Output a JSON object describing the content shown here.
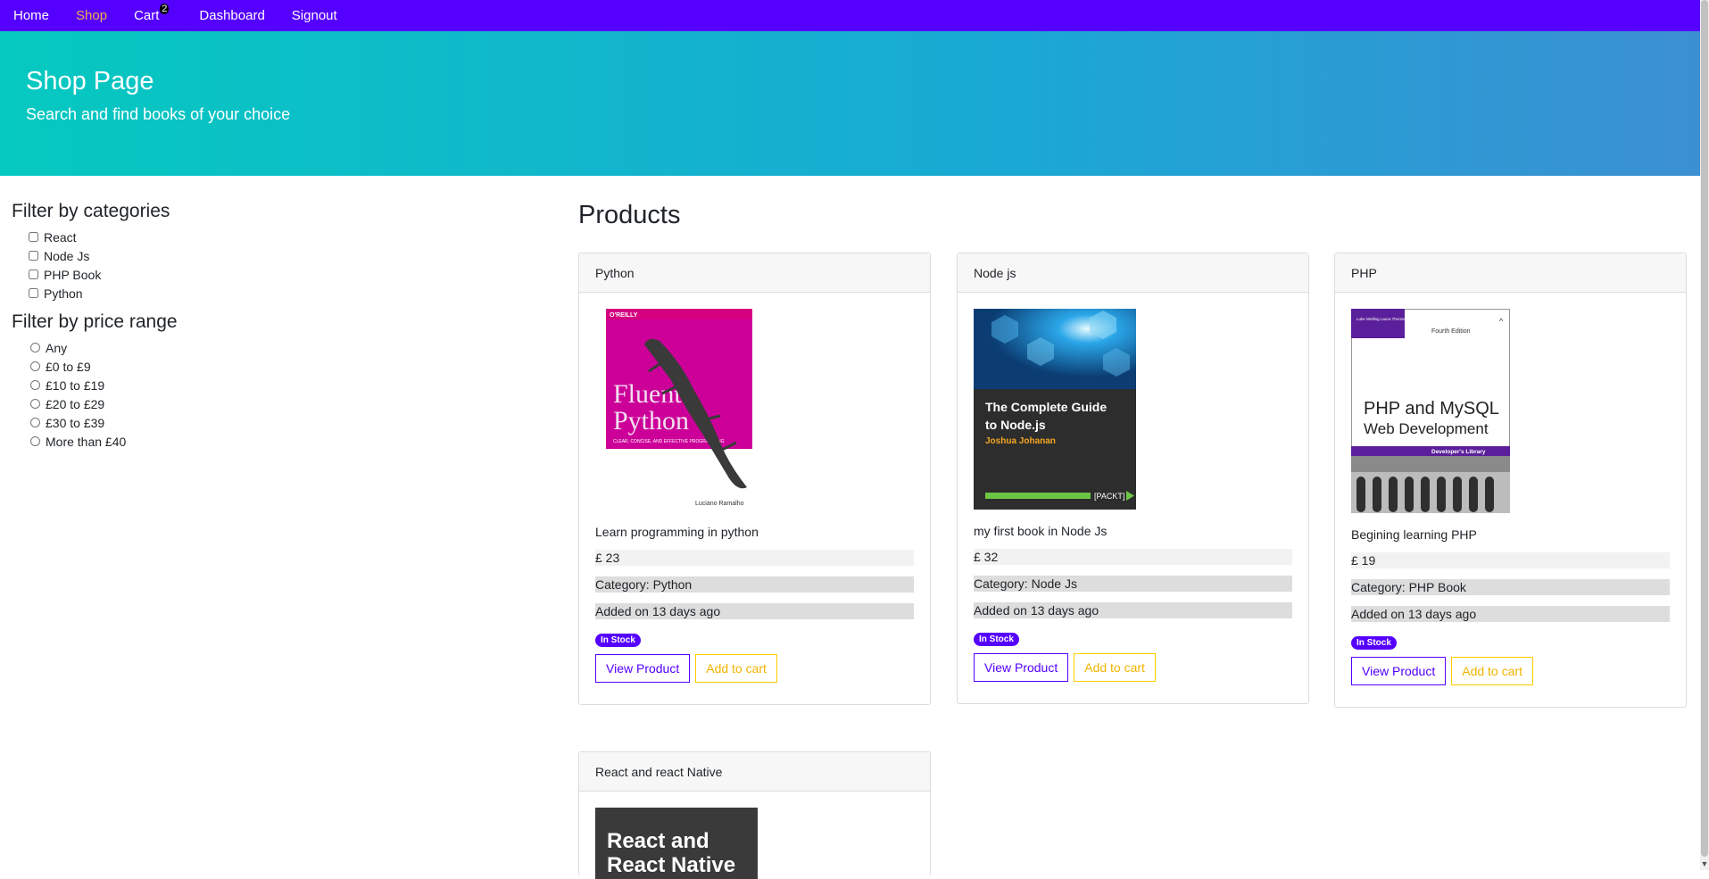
{
  "nav": {
    "items": [
      "Home",
      "Shop",
      "Cart",
      "Dashboard",
      "Signout"
    ],
    "cart_count": "2"
  },
  "hero": {
    "title": "Shop Page",
    "subtitle": "Search and find books of your choice"
  },
  "sidebar": {
    "categories_title": "Filter by categories",
    "categories": [
      "React",
      "Node Js",
      "PHP Book",
      "Python"
    ],
    "price_title": "Filter by price range",
    "prices": [
      "Any",
      "£0 to £9",
      "£10 to £19",
      "£20 to £29",
      "£30 to £39",
      "More than £40"
    ]
  },
  "products_title": "Products",
  "products": [
    {
      "name": "Python",
      "description": "Learn programming in python",
      "price": "£ 23",
      "category": "Category: Python",
      "added": "Added on 13 days ago",
      "stock": "In Stock",
      "view_label": "View Product",
      "add_label": "Add to cart",
      "cover": {
        "publisher": "O'REILLY",
        "title1": "Fluent",
        "title2": "Python",
        "tagline": "CLEAR, CONCISE, AND EFFECTIVE PROGRAMMING",
        "author": "Luciano Ramalho"
      }
    },
    {
      "name": "Node js",
      "description": "my first book in Node Js",
      "price": "£ 32",
      "category": "Category: Node Js",
      "added": "Added on 13 days ago",
      "stock": "In Stock",
      "view_label": "View Product",
      "add_label": "Add to cart",
      "cover": {
        "title1": "The Complete Guide",
        "title2": "to Node.js",
        "author": "Joshua Johanan",
        "publisher": "[PACKT]"
      }
    },
    {
      "name": "PHP",
      "description": "Begining learning PHP",
      "price": "£ 19",
      "category": "Category: PHP Book",
      "added": "Added on 13 days ago",
      "stock": "In Stock",
      "view_label": "View Product",
      "add_label": "Add to cart",
      "cover": {
        "authors": "Luke Welling Laura Thomson",
        "edition": "Fourth Edition",
        "title1": "PHP and MySQL",
        "title2": "Web Development",
        "series": "Developer's Library"
      }
    },
    {
      "name": "React and react Native",
      "cover": {
        "title1": "React and",
        "title2": "React Native"
      }
    }
  ],
  "colors": {
    "navbar": "#5500ff",
    "active_link": "#f0ad4e",
    "primary": "#5500ff",
    "warning": "#ffcc00"
  }
}
